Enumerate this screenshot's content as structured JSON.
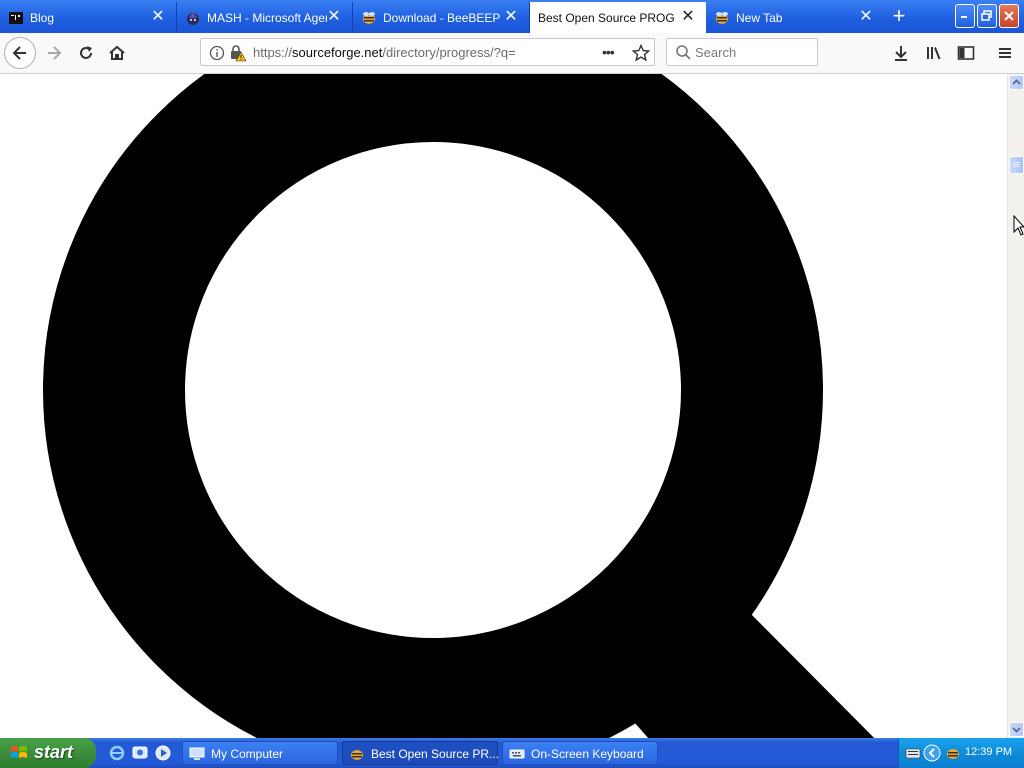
{
  "browser": {
    "tabs": [
      {
        "title": "Blog",
        "active": false,
        "favicon": "terminal-icon"
      },
      {
        "title": "MASH - Microsoft Agent",
        "active": false,
        "favicon": "wizard-icon"
      },
      {
        "title": "Download - BeeBEEP - F",
        "active": false,
        "favicon": "sourceforge-icon"
      },
      {
        "title": "Best Open Source PROGRES",
        "active": true,
        "favicon": "none"
      },
      {
        "title": "New Tab",
        "active": false,
        "favicon": "sourceforge-icon"
      }
    ],
    "new_tab_symbol": "+",
    "close_symbol": "✕",
    "url": {
      "prefix": "https://",
      "host": "sourceforge.net",
      "path": "/directory/progress/?q="
    },
    "page_actions_symbol": "•••",
    "search": {
      "placeholder": "Search"
    }
  },
  "page": {
    "glyph": "Q",
    "glyph_icon": "search-magnifier-icon"
  },
  "taskbar": {
    "start_label": "start",
    "tasks": [
      {
        "label": "My Computer",
        "icon": "my-computer-icon",
        "active": false
      },
      {
        "label": "Best Open Source PR...",
        "icon": "firefox-icon",
        "active": true
      },
      {
        "label": "On-Screen Keyboard",
        "icon": "keyboard-icon",
        "active": false
      }
    ],
    "clock": "12:39 PM"
  },
  "colors": {
    "xp_blue": "#245ad8",
    "start_green": "#3c8c3c",
    "tray_blue": "#0f8bd9"
  }
}
